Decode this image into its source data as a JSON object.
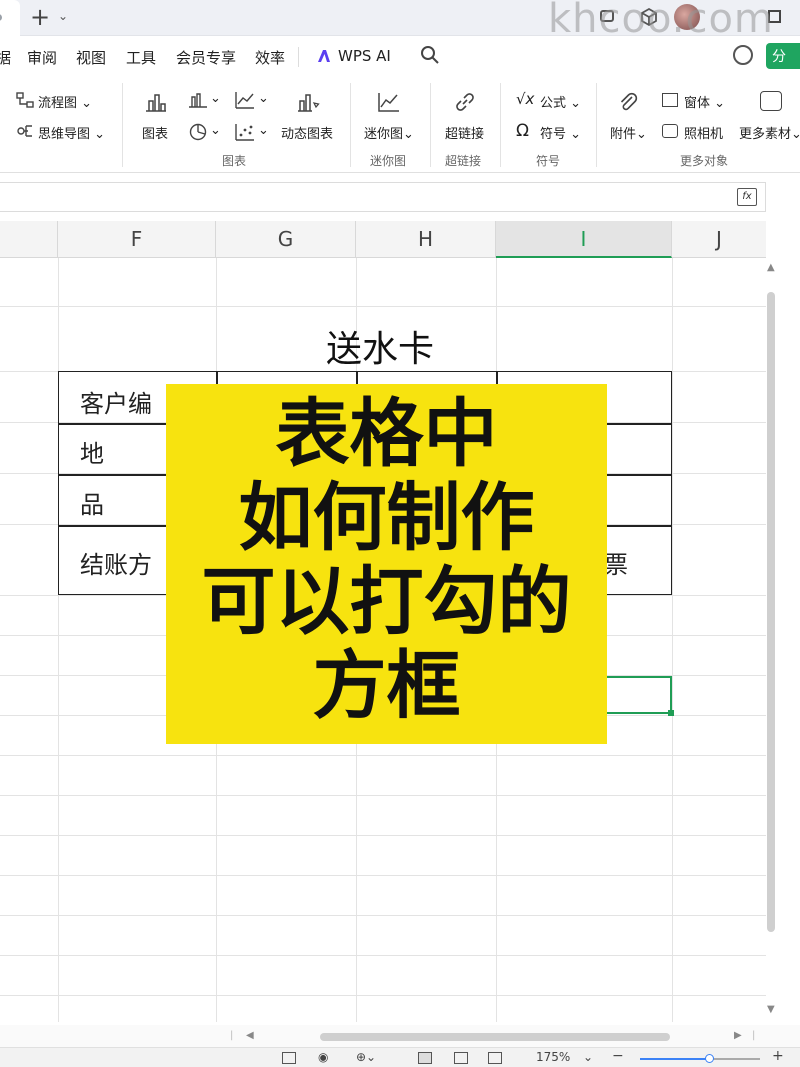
{
  "watermark": "khcoo.com",
  "menu": {
    "items": [
      "审阅",
      "视图",
      "工具",
      "会员专享",
      "效率"
    ],
    "ai_label": "WPS AI",
    "share_label": "分"
  },
  "ribbon": {
    "flowchart": "流程图",
    "mindmap": "思维导图",
    "chart": "图表",
    "dynamic_chart": "动态图表",
    "chart_group": "图表",
    "sparkline": "迷你图",
    "sparkline_group": "迷你图",
    "hyperlink": "超链接",
    "hyperlink_group": "超链接",
    "formula": "公式",
    "symbol": "符号",
    "symbol_group": "符号",
    "attachment": "附件",
    "window": "窗体",
    "camera": "照相机",
    "more_materials": "更多素材",
    "more_objects_group": "更多对象"
  },
  "columns": [
    "F",
    "G",
    "H",
    "I",
    "J"
  ],
  "selected_column": "I",
  "sheet": {
    "title": "送水卡",
    "rows": [
      "客户编",
      "地",
      "品",
      "结账方"
    ],
    "ticket_text": "票"
  },
  "overlay": {
    "lines": [
      "表格中",
      "如何制作",
      "可以打勾的",
      "方框"
    ],
    "background": "#f7e30f"
  },
  "status": {
    "zoom": "175%",
    "zoom_level": 0.58
  },
  "colors": {
    "accent_green": "#1f9d55",
    "share_green": "#1fa560"
  }
}
